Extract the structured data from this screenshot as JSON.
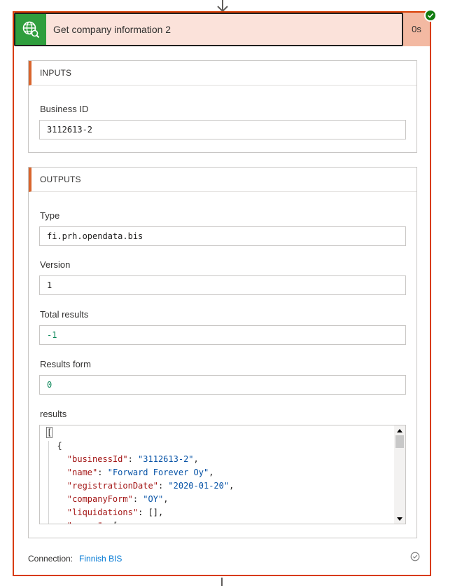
{
  "action": {
    "title": "Get company information 2",
    "duration": "0s",
    "icon": "globe-search-icon",
    "status": "succeeded"
  },
  "inputs": {
    "heading": "INPUTS",
    "fields": [
      {
        "label": "Business ID",
        "value": "3112613-2"
      }
    ]
  },
  "outputs": {
    "heading": "OUTPUTS",
    "type_label": "Type",
    "type_value": "fi.prh.opendata.bis",
    "version_label": "Version",
    "version_value": "1",
    "total_label": "Total results",
    "total_value": "-1",
    "form_label": "Results form",
    "form_value": "0",
    "results_label": "results",
    "results_lines": [
      {
        "text": "["
      },
      {
        "text": "  {"
      },
      {
        "key": "\"businessId\"",
        "value": "\"3112613-2\"",
        "tail": ","
      },
      {
        "key": "\"name\"",
        "value": "\"Forward Forever Oy\"",
        "tail": ","
      },
      {
        "key": "\"registrationDate\"",
        "value": "\"2020-01-20\"",
        "tail": ","
      },
      {
        "key": "\"companyForm\"",
        "value": "\"OY\"",
        "tail": ","
      },
      {
        "key": "\"liquidations\"",
        "value": "[]",
        "tail": ","
      },
      {
        "key": "\"names\"",
        "value": "[",
        "tail": ""
      }
    ]
  },
  "footer": {
    "connection_label": "Connection:",
    "connection_name": "Finnish BIS"
  },
  "colors": {
    "accent": "#d83b01",
    "header_bg": "#fbe2da",
    "icon_bg": "#2f9e3d",
    "success": "#107c10",
    "link": "#0078d4"
  }
}
